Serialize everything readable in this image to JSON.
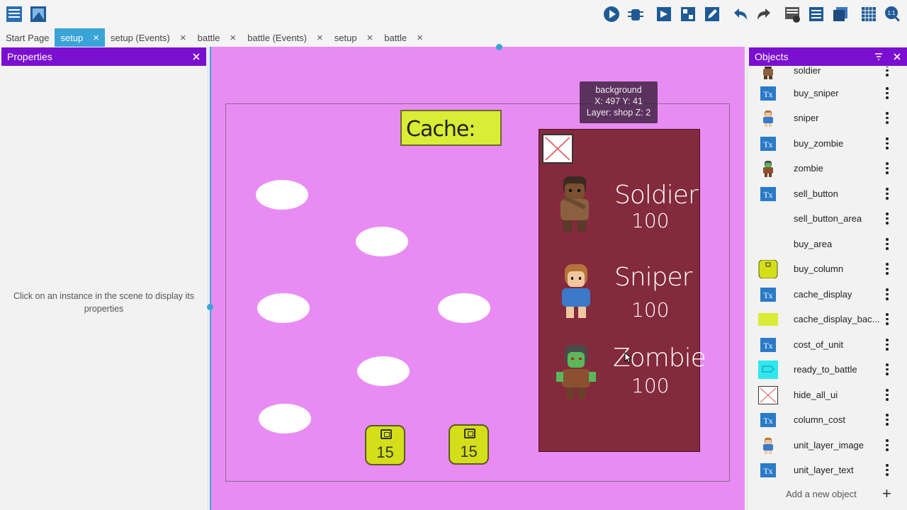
{
  "tabs": [
    {
      "label": "Start Page",
      "active": false,
      "closable": false
    },
    {
      "label": "setup",
      "active": true,
      "closable": true
    },
    {
      "label": "setup (Events)",
      "active": false,
      "closable": true
    },
    {
      "label": "battle",
      "active": false,
      "closable": true
    },
    {
      "label": "battle (Events)",
      "active": false,
      "closable": true
    },
    {
      "label": "setup",
      "active": false,
      "closable": true
    },
    {
      "label": "battle",
      "active": false,
      "closable": true
    }
  ],
  "tab_close_glyph": "×",
  "properties": {
    "title": "Properties",
    "hint": "Click on an instance in the scene to display its properties"
  },
  "scene": {
    "cache_label": "Cache:",
    "tooltip": {
      "name": "background",
      "coords": "X: 497  Y: 41",
      "layer": "Layer: shop  Z: 2"
    },
    "coins": [
      {
        "value": "15"
      },
      {
        "value": "15"
      }
    ],
    "shop_units": [
      {
        "name": "Soldier",
        "cost": "100"
      },
      {
        "name": "Sniper",
        "cost": "100"
      },
      {
        "name": "Zombie",
        "cost": "100"
      }
    ],
    "colors": {
      "background": "#e88cf4",
      "shop": "#832a3d",
      "cache_box": "#d9ec36",
      "coin": "#d4df1a",
      "accent": "#3aa3d8",
      "panel_header": "#7a0fcf"
    }
  },
  "objects": {
    "title": "Objects",
    "items": [
      {
        "name": "soldier",
        "thumb": "soldier-sprite"
      },
      {
        "name": "buy_sniper",
        "thumb": "text-object"
      },
      {
        "name": "sniper",
        "thumb": "sniper-sprite"
      },
      {
        "name": "buy_zombie",
        "thumb": "text-object"
      },
      {
        "name": "zombie",
        "thumb": "zombie-sprite"
      },
      {
        "name": "sell_button",
        "thumb": "text-object"
      },
      {
        "name": "sell_button_area",
        "thumb": "none"
      },
      {
        "name": "buy_area",
        "thumb": "none"
      },
      {
        "name": "buy_column",
        "thumb": "coin-tile"
      },
      {
        "name": "cache_display",
        "thumb": "text-object"
      },
      {
        "name": "cache_display_bac...",
        "thumb": "yellow-rect"
      },
      {
        "name": "cost_of_unit",
        "thumb": "text-object"
      },
      {
        "name": "ready_to_battle",
        "thumb": "cyan-button"
      },
      {
        "name": "hide_all_ui",
        "thumb": "cross-box"
      },
      {
        "name": "column_cost",
        "thumb": "text-object"
      },
      {
        "name": "unit_layer_image",
        "thumb": "sniper-sprite"
      },
      {
        "name": "unit_layer_text",
        "thumb": "text-object"
      }
    ],
    "add_label": "Add a new object",
    "add_glyph": "+"
  }
}
